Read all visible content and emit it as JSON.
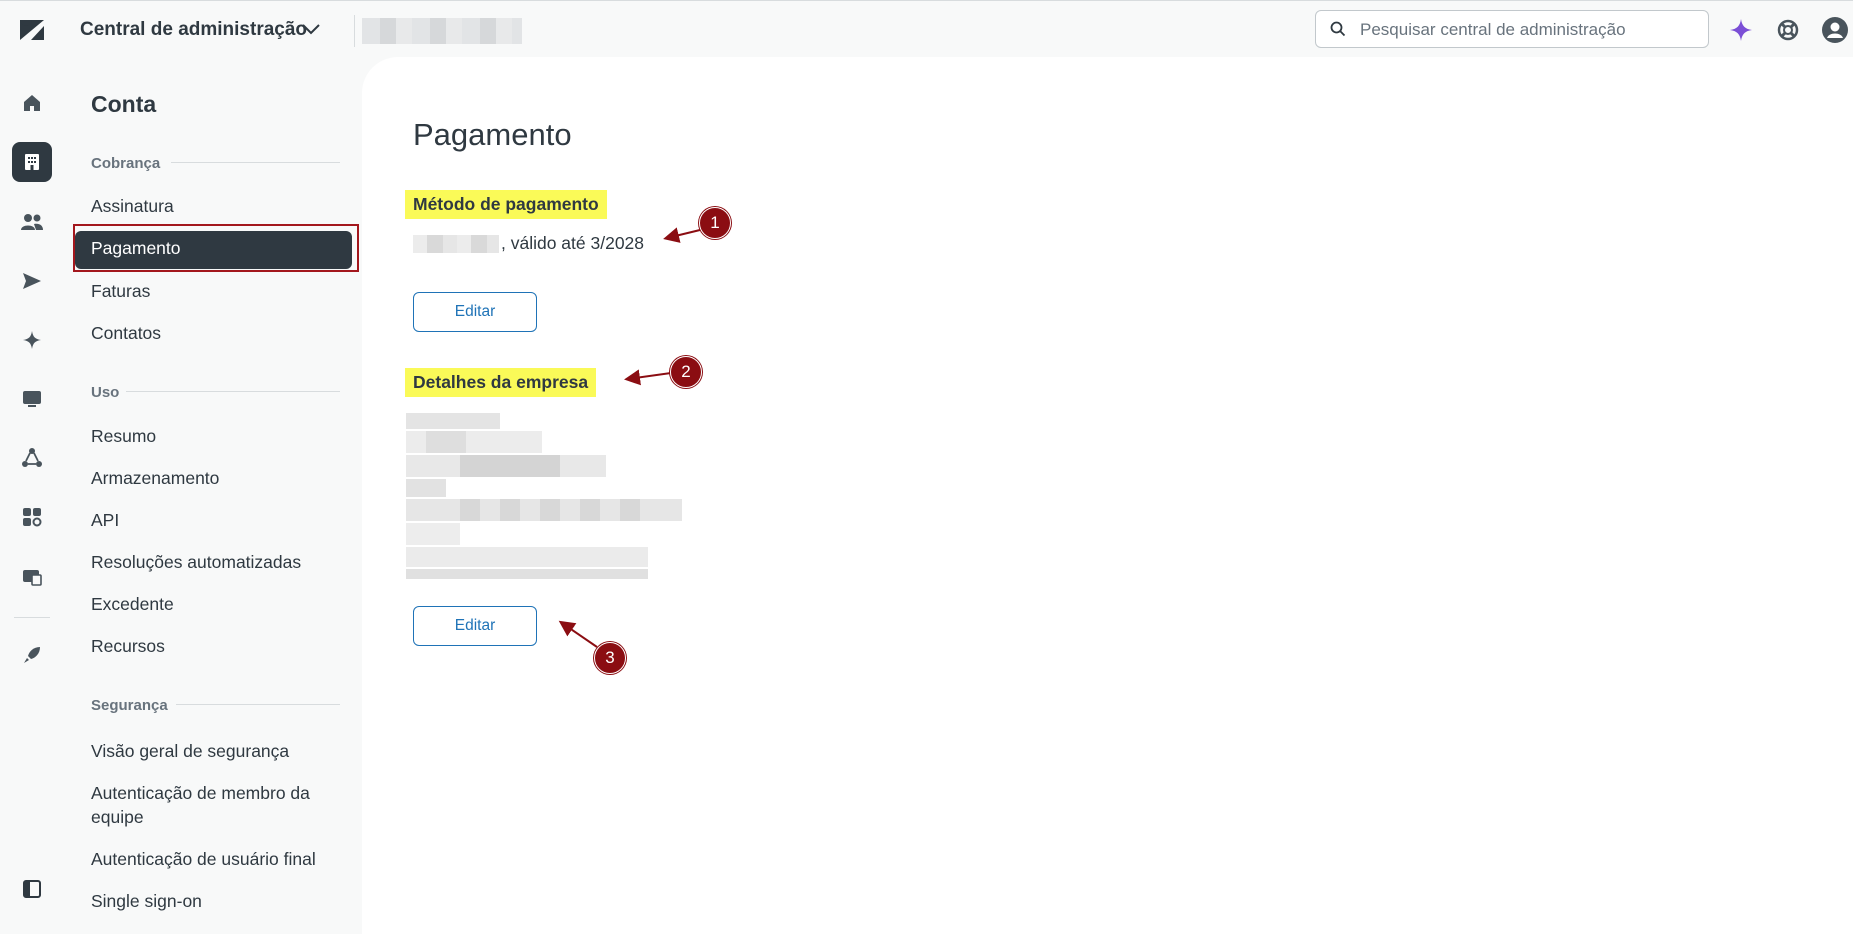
{
  "header": {
    "app_title": "Central de administração",
    "search_placeholder": "Pesquisar central de administração"
  },
  "subnav": {
    "title": "Conta",
    "sections": {
      "billing": "Cobrança",
      "usage": "Uso",
      "security": "Segurança"
    },
    "items": {
      "subscription": "Assinatura",
      "payment": "Pagamento",
      "invoices": "Faturas",
      "contacts": "Contatos",
      "summary": "Resumo",
      "storage": "Armazenamento",
      "api": "API",
      "automated_resolutions": "Resoluções automatizadas",
      "overage": "Excedente",
      "resources": "Recursos",
      "security_overview": "Visão geral de segurança",
      "team_member_auth": "Autenticação de membro da equipe",
      "end_user_auth": "Autenticação de usuário final",
      "sso": "Single sign-on"
    }
  },
  "main": {
    "title": "Pagamento",
    "payment_method": {
      "heading": "Método de pagamento",
      "validity": ", válido até 3/2028",
      "edit_label": "Editar"
    },
    "company_details": {
      "heading": "Detalhes da empresa",
      "edit_label": "Editar"
    }
  },
  "annotations": [
    "1",
    "2",
    "3"
  ],
  "colors": {
    "accent": "#1f73b7",
    "highlight": "#fafa58",
    "annotation": "#8b0d12",
    "active_nav": "#2f3941"
  }
}
